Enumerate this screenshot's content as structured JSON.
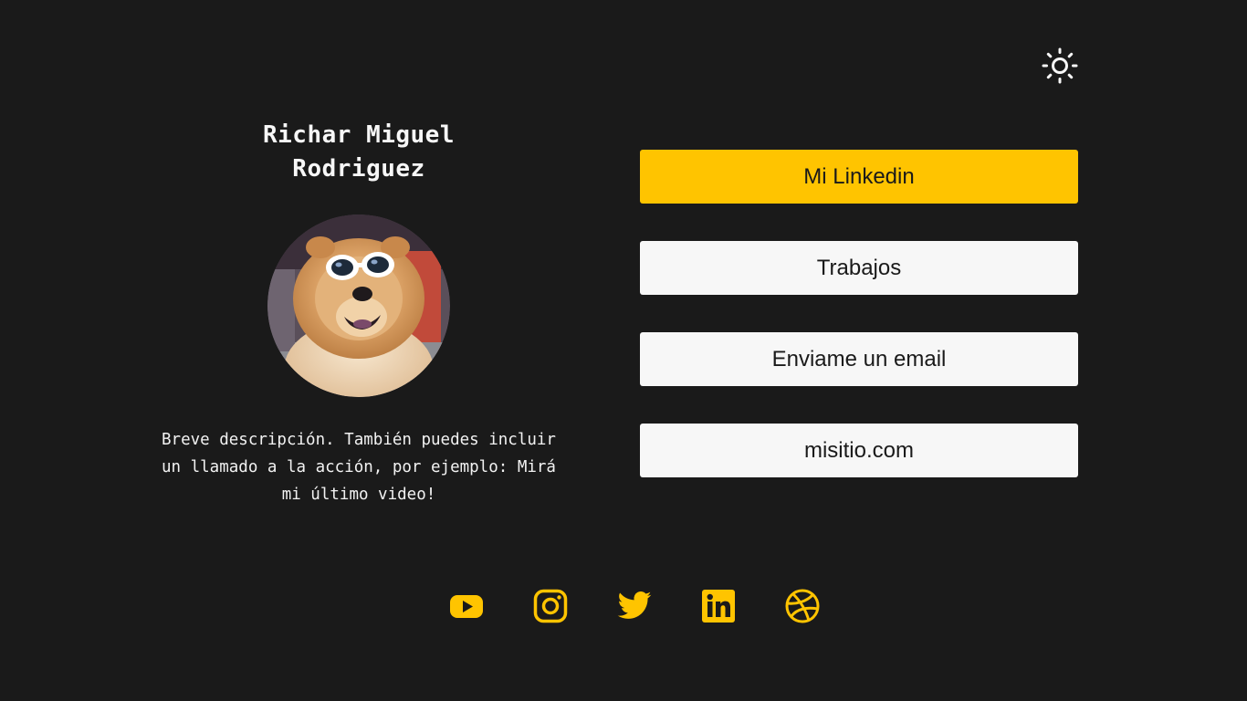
{
  "profile": {
    "name": "Richar Miguel Rodriguez",
    "avatar_alt": "Perro con gafas de sol",
    "description": "Breve descripción. También puedes incluir un llamado a la acción, por ejemplo: Mirá mi último video!"
  },
  "theme_toggle": {
    "icon": "sun-icon"
  },
  "links": [
    {
      "label": "Mi Linkedin",
      "style": "primary"
    },
    {
      "label": "Trabajos",
      "style": "secondary"
    },
    {
      "label": "Enviame un email",
      "style": "secondary"
    },
    {
      "label": "misitio.com",
      "style": "secondary"
    }
  ],
  "socials": [
    {
      "icon": "youtube-icon"
    },
    {
      "icon": "instagram-icon"
    },
    {
      "icon": "twitter-icon"
    },
    {
      "icon": "linkedin-icon"
    },
    {
      "icon": "dribbble-icon"
    }
  ],
  "colors": {
    "background": "#1a1a1a",
    "accent": "#ffc400",
    "button_light": "#f7f7f7",
    "text_light": "#f7f7f7",
    "text_dark": "#1a1a1a"
  }
}
